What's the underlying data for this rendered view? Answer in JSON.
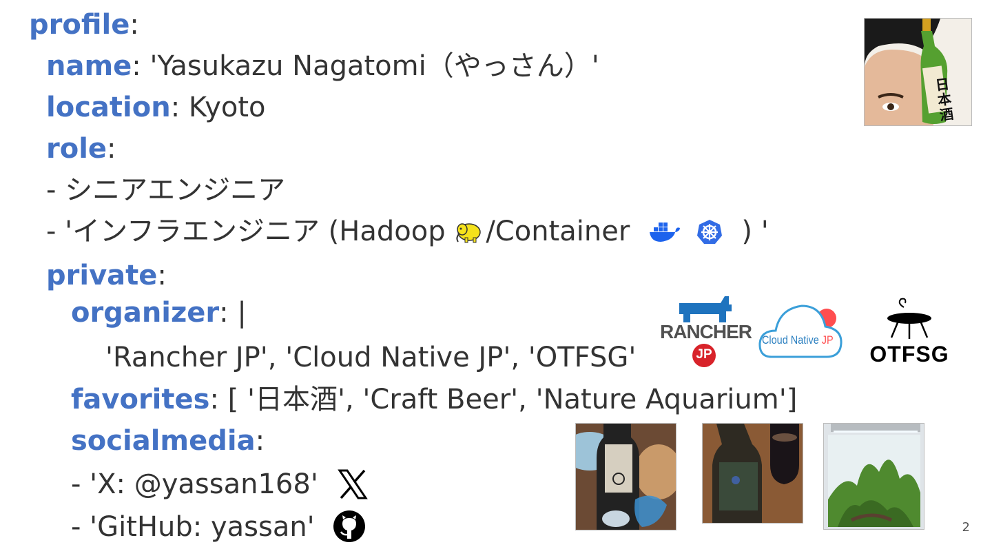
{
  "profile": {
    "key": "profile",
    "name_key": "name",
    "name_value": "'Yasukazu Nagatomi（やっさん）'",
    "location_key": "location",
    "location_value": "Kyoto",
    "role_key": "role",
    "roles": [
      "- シニアエンジニア",
      "- 'インフラエンジニア (Hadoop",
      "/Container",
      ") '"
    ]
  },
  "private": {
    "key": "private",
    "organizer_key": "organizer",
    "organizer_pipe": "|",
    "organizer_value": "'Rancher JP', 'Cloud Native JP', 'OTFSG'",
    "favorites_key": "favorites",
    "favorites_value": "[ '日本酒', 'Craft Beer', 'Nature Aquarium']",
    "socialmedia_key": "socialmedia",
    "social": [
      "- 'X: @yassan168'",
      "- 'GitHub: yassan'"
    ]
  },
  "logos": {
    "rancher": "RANCHER",
    "rancher_jp": "JP",
    "cloudnative": "Cloud Native",
    "cloudnative_jp": "JP",
    "otfsg": "OTFSG"
  },
  "sake_label": "日本酒",
  "page_number": "2",
  "icons": [
    "hadoop-elephant-icon",
    "docker-whale-icon",
    "kubernetes-helm-icon",
    "x-logo-icon",
    "github-octocat-icon"
  ],
  "colors": {
    "key": "#4472c4",
    "text": "#333333",
    "rancher_blue": "#1e73be",
    "rancher_red": "#d8232a"
  }
}
